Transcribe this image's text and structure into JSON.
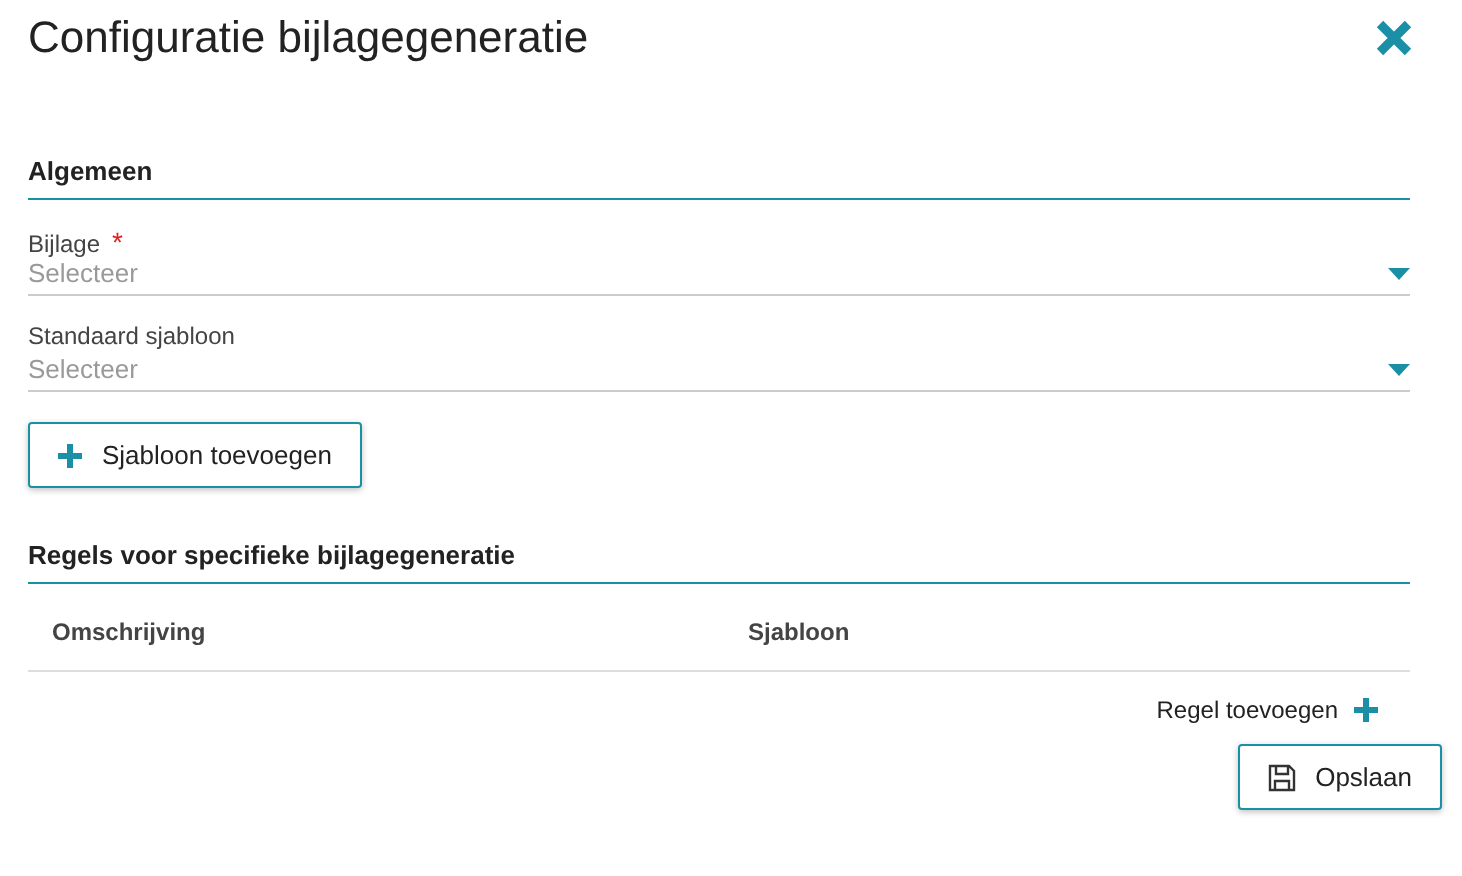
{
  "dialog": {
    "title": "Configuratie bijlagegeneratie"
  },
  "sections": [
    {
      "heading": "Algemeen",
      "fields": [
        {
          "label": "Bijlage",
          "required_mark": "*",
          "placeholder": "Selecteer"
        },
        {
          "label": "Standaard sjabloon",
          "placeholder": "Selecteer"
        }
      ],
      "button": "Sjabloon toevoegen"
    },
    {
      "heading": "Regels voor specifieke bijlagegeneratie",
      "table": {
        "columns": [
          "Omschrijving",
          "Sjabloon"
        ]
      },
      "add_link": "Regel toevoegen"
    }
  ],
  "footer": {
    "save_button": "Opslaan"
  }
}
